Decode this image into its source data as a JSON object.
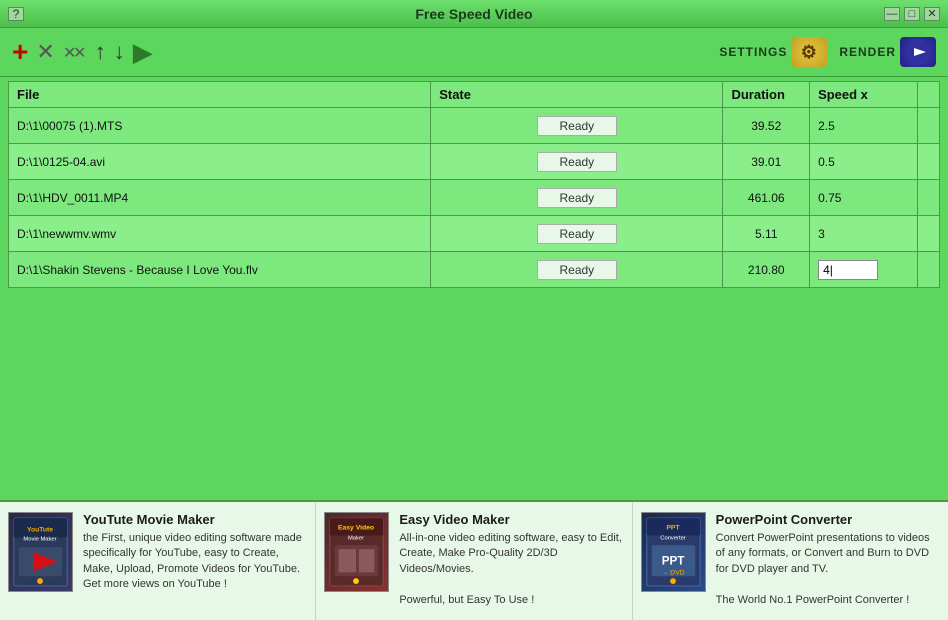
{
  "window": {
    "title": "Free Speed Video",
    "help": "?",
    "minimize": "—",
    "maximize": "□",
    "close": "✕"
  },
  "toolbar": {
    "add_label": "+",
    "delete_label": "✕",
    "delete_all_label": "✖✕",
    "up_label": "↑",
    "down_label": "↓",
    "play_label": "▶",
    "settings_label": "Settings",
    "render_label": "Render"
  },
  "table": {
    "columns": [
      "File",
      "State",
      "Duration",
      "Speed x"
    ],
    "rows": [
      {
        "file": "D:\\1\\00075 (1).MTS",
        "state": "Ready",
        "duration": "39.52",
        "speed": "2.5"
      },
      {
        "file": "D:\\1\\0125-04.avi",
        "state": "Ready",
        "duration": "39.01",
        "speed": "0.5"
      },
      {
        "file": "D:\\1\\HDV_0011.MP4",
        "state": "Ready",
        "duration": "461.06",
        "speed": "0.75"
      },
      {
        "file": "D:\\1\\newwmv.wmv",
        "state": "Ready",
        "duration": "5.11",
        "speed": "3"
      },
      {
        "file": "D:\\1\\Shakin Stevens - Because I Love You.flv",
        "state": "Ready",
        "duration": "210.80",
        "speed": "4|"
      }
    ]
  },
  "ads": [
    {
      "title": "YouTute Movie Maker",
      "description": "the First, unique video editing software made specifically for YouTube, easy to Create, Make, Upload, Promote Videos for YouTube.\nGet more views on YouTube !",
      "thumb_label": "YouTube\nMovie Maker"
    },
    {
      "title": "Easy Video Maker",
      "description": "All-in-one video editing software, easy to Edit, Create, Make Pro-Quality 2D/3D Videos/Movies.\n\nPowerful, but Easy To Use !",
      "thumb_label": "Easy Video\nMaker"
    },
    {
      "title": "PowerPoint Converter",
      "description": "Convert PowerPoint presentations to videos of any formats, or Convert and Burn to DVD for DVD player and TV.\n\nThe World No.1 PowerPoint Converter !",
      "thumb_label": "PPT\nConverter"
    }
  ]
}
